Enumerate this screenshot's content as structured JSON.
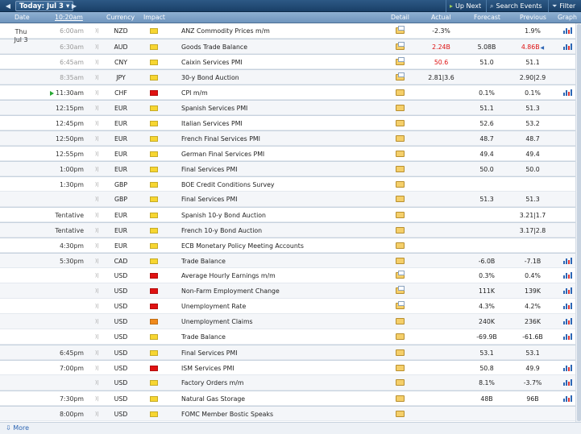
{
  "toolbar": {
    "prev_icon": "◀",
    "today_label": "Today: Jul 3",
    "today_icon": "▾",
    "next_icon": "▶",
    "up_next_label": "Up Next",
    "search_label": "Search Events",
    "filter_label": "Filter"
  },
  "columns": {
    "date": "Date",
    "time": "10:20am",
    "currency": "Currency",
    "impact": "Impact",
    "detail": "Detail",
    "actual": "Actual",
    "forecast": "Forecast",
    "previous": "Previous",
    "graph": "Graph"
  },
  "date_group": {
    "day": "Thu",
    "date": "Jul 3"
  },
  "impact_colors": {
    "low": "#f7d631",
    "medium": "#f08a1c",
    "high": "#e01212"
  },
  "rows": [
    {
      "time": "6:00am",
      "past": true,
      "currency": "NZD",
      "impact": "low",
      "event": "ANZ Commodity Prices m/m",
      "detail": "note",
      "actual": "-2.3%",
      "forecast": "",
      "previous": "1.9%",
      "graph": true
    },
    {
      "time": "6:30am",
      "past": true,
      "currency": "AUD",
      "impact": "low",
      "event": "Goods Trade Balance",
      "detail": "note",
      "actual": "2.24B",
      "actual_red": true,
      "forecast": "5.08B",
      "previous": "4.86B",
      "previous_red": true,
      "revised": true,
      "graph": true
    },
    {
      "time": "6:45am",
      "past": true,
      "currency": "CNY",
      "impact": "low",
      "event": "Caixin Services PMI",
      "detail": "note",
      "actual": "50.6",
      "actual_red": true,
      "forecast": "51.0",
      "previous": "51.1",
      "graph": false
    },
    {
      "time": "8:35am",
      "past": true,
      "currency": "JPY",
      "impact": "low",
      "event": "30-y Bond Auction",
      "detail": "note",
      "actual": "2.81|3.6",
      "forecast": "",
      "previous": "2.90|2.9",
      "graph": false
    },
    {
      "time": "11:30am",
      "live": true,
      "currency": "CHF",
      "impact": "high",
      "event": "CPI m/m",
      "detail": "plain",
      "actual": "",
      "forecast": "0.1%",
      "previous": "0.1%",
      "graph": true
    },
    {
      "time": "12:15pm",
      "currency": "EUR",
      "impact": "low",
      "event": "Spanish Services PMI",
      "detail": "plain",
      "actual": "",
      "forecast": "51.1",
      "previous": "51.3",
      "graph": false
    },
    {
      "time": "12:45pm",
      "currency": "EUR",
      "impact": "low",
      "event": "Italian Services PMI",
      "detail": "plain",
      "actual": "",
      "forecast": "52.6",
      "previous": "53.2",
      "graph": false
    },
    {
      "time": "12:50pm",
      "currency": "EUR",
      "impact": "low",
      "event": "French Final Services PMI",
      "detail": "plain",
      "actual": "",
      "forecast": "48.7",
      "previous": "48.7",
      "graph": false
    },
    {
      "time": "12:55pm",
      "currency": "EUR",
      "impact": "low",
      "event": "German Final Services PMI",
      "detail": "plain",
      "actual": "",
      "forecast": "49.4",
      "previous": "49.4",
      "graph": false
    },
    {
      "time": "1:00pm",
      "currency": "EUR",
      "impact": "low",
      "event": "Final Services PMI",
      "detail": "plain",
      "actual": "",
      "forecast": "50.0",
      "previous": "50.0",
      "graph": false
    },
    {
      "time": "1:30pm",
      "currency": "GBP",
      "impact": "low",
      "event": "BOE Credit Conditions Survey",
      "detail": "plain",
      "actual": "",
      "forecast": "",
      "previous": "",
      "graph": false
    },
    {
      "time": "",
      "currency": "GBP",
      "impact": "low",
      "event": "Final Services PMI",
      "detail": "plain",
      "actual": "",
      "forecast": "51.3",
      "previous": "51.3",
      "graph": false
    },
    {
      "time": "Tentative",
      "currency": "EUR",
      "impact": "low",
      "event": "Spanish 10-y Bond Auction",
      "detail": "plain",
      "actual": "",
      "forecast": "",
      "previous": "3.21|1.7",
      "graph": false
    },
    {
      "time": "Tentative",
      "currency": "EUR",
      "impact": "low",
      "event": "French 10-y Bond Auction",
      "detail": "plain",
      "actual": "",
      "forecast": "",
      "previous": "3.17|2.8",
      "graph": false
    },
    {
      "time": "4:30pm",
      "currency": "EUR",
      "impact": "low",
      "event": "ECB Monetary Policy Meeting Accounts",
      "detail": "plain",
      "actual": "",
      "forecast": "",
      "previous": "",
      "graph": false
    },
    {
      "time": "5:30pm",
      "currency": "CAD",
      "impact": "low",
      "event": "Trade Balance",
      "detail": "plain",
      "actual": "",
      "forecast": "-6.0B",
      "previous": "-7.1B",
      "graph": true
    },
    {
      "time": "",
      "currency": "USD",
      "impact": "high",
      "event": "Average Hourly Earnings m/m",
      "detail": "note",
      "actual": "",
      "forecast": "0.3%",
      "previous": "0.4%",
      "graph": true
    },
    {
      "time": "",
      "currency": "USD",
      "impact": "high",
      "event": "Non-Farm Employment Change",
      "detail": "note",
      "actual": "",
      "forecast": "111K",
      "previous": "139K",
      "graph": true
    },
    {
      "time": "",
      "currency": "USD",
      "impact": "high",
      "event": "Unemployment Rate",
      "detail": "note",
      "actual": "",
      "forecast": "4.3%",
      "previous": "4.2%",
      "graph": true
    },
    {
      "time": "",
      "currency": "USD",
      "impact": "medium",
      "event": "Unemployment Claims",
      "detail": "plain",
      "actual": "",
      "forecast": "240K",
      "previous": "236K",
      "graph": true
    },
    {
      "time": "",
      "currency": "USD",
      "impact": "low",
      "event": "Trade Balance",
      "detail": "plain",
      "actual": "",
      "forecast": "-69.9B",
      "previous": "-61.6B",
      "graph": true
    },
    {
      "time": "6:45pm",
      "currency": "USD",
      "impact": "low",
      "event": "Final Services PMI",
      "detail": "plain",
      "actual": "",
      "forecast": "53.1",
      "previous": "53.1",
      "graph": false
    },
    {
      "time": "7:00pm",
      "currency": "USD",
      "impact": "high",
      "event": "ISM Services PMI",
      "detail": "plain",
      "actual": "",
      "forecast": "50.8",
      "previous": "49.9",
      "graph": true
    },
    {
      "time": "",
      "currency": "USD",
      "impact": "low",
      "event": "Factory Orders m/m",
      "detail": "plain",
      "actual": "",
      "forecast": "8.1%",
      "previous": "-3.7%",
      "graph": true
    },
    {
      "time": "7:30pm",
      "currency": "USD",
      "impact": "low",
      "event": "Natural Gas Storage",
      "detail": "plain",
      "actual": "",
      "forecast": "48B",
      "previous": "96B",
      "graph": true
    },
    {
      "time": "8:00pm",
      "currency": "USD",
      "impact": "low",
      "event": "FOMC Member Bostic Speaks",
      "detail": "plain",
      "actual": "",
      "forecast": "",
      "previous": "",
      "graph": false
    }
  ],
  "footer": {
    "more_label": "More",
    "more_icon": "⇩"
  }
}
